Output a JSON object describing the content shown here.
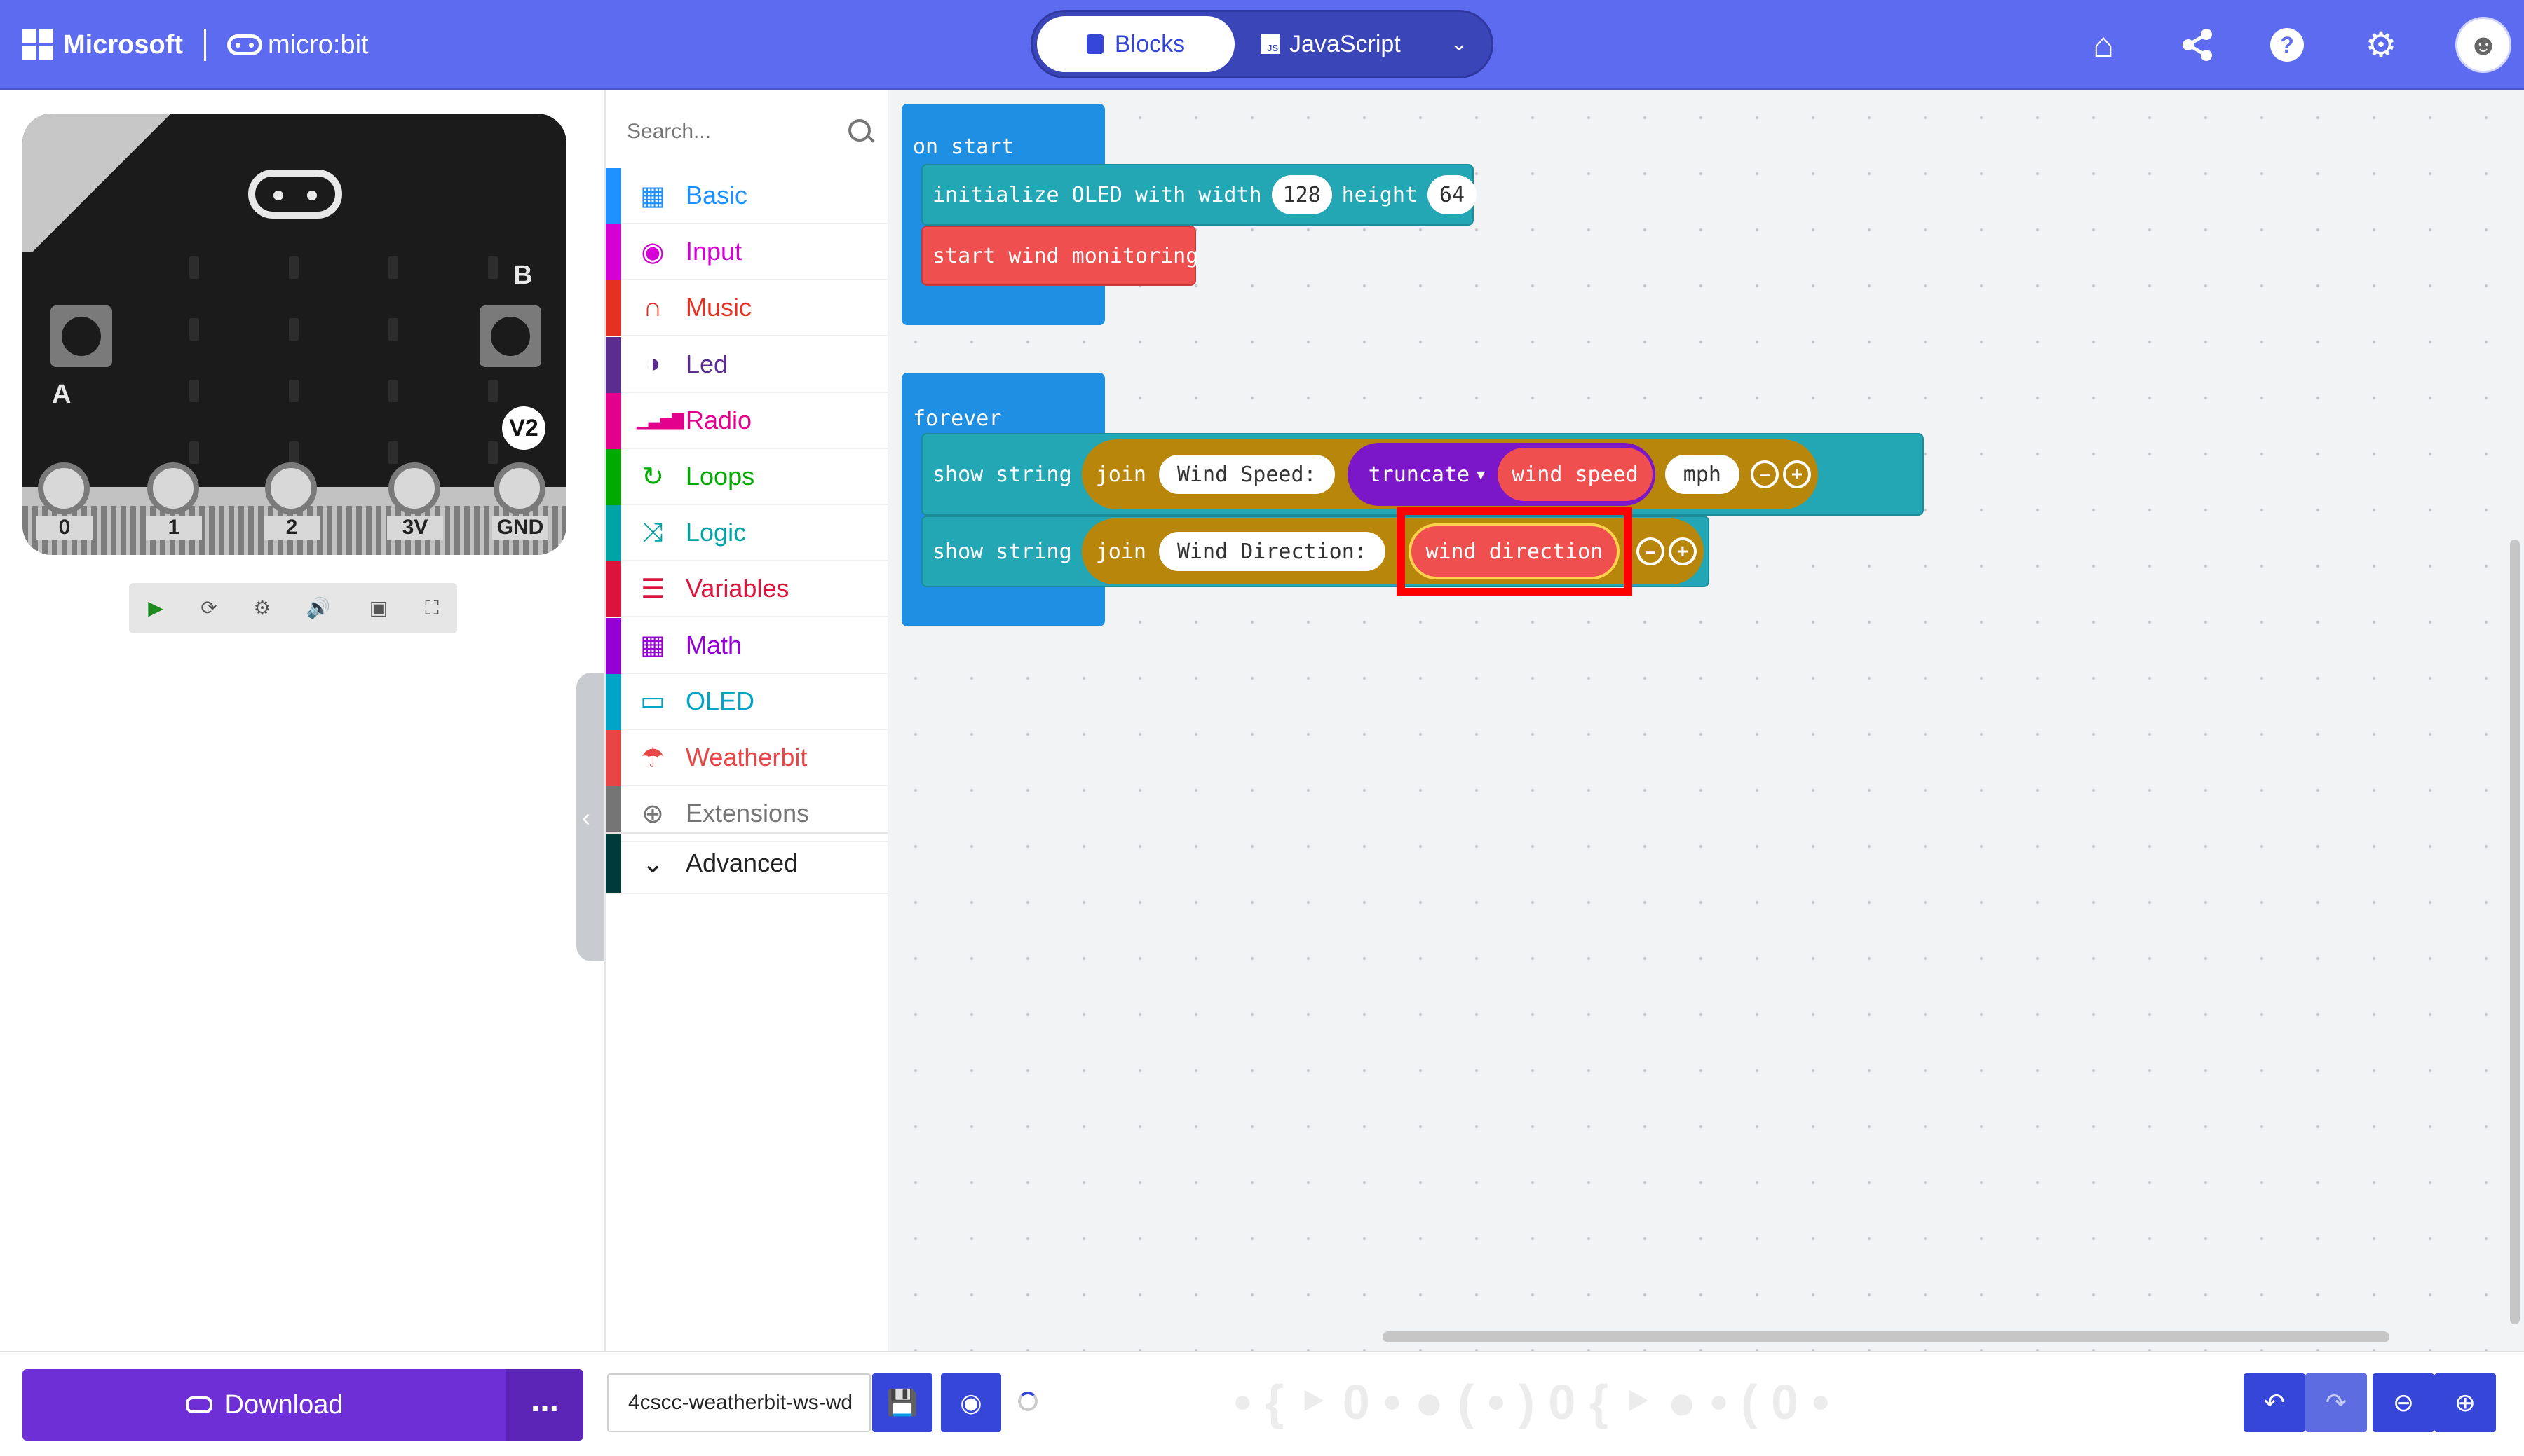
{
  "header": {
    "brand": "Microsoft",
    "product": "micro:bit",
    "modes": {
      "blocks": "Blocks",
      "javascript": "JavaScript"
    },
    "js_icon_text": "JS",
    "icons": [
      "home-icon",
      "share-icon",
      "help-icon",
      "settings-icon",
      "user-avatar"
    ]
  },
  "simulator": {
    "button_a": "A",
    "button_b": "B",
    "version_badge": "V2",
    "pins": [
      "0",
      "1",
      "2",
      "3V",
      "GND"
    ],
    "toolbar_icons": [
      "play-icon",
      "restart-icon",
      "debug-icon",
      "mute-icon",
      "screenshot-icon",
      "fullscreen-icon"
    ]
  },
  "toolbox": {
    "search_placeholder": "Search...",
    "categories": [
      {
        "label": "Basic",
        "color": "#1e90ff",
        "icon": "grid-icon"
      },
      {
        "label": "Input",
        "color": "#d400d4",
        "icon": "target-icon"
      },
      {
        "label": "Music",
        "color": "#e63022",
        "icon": "headphones-icon"
      },
      {
        "label": "Led",
        "color": "#5c2d91",
        "icon": "toggle-icon"
      },
      {
        "label": "Radio",
        "color": "#e3008c",
        "icon": "signal-icon"
      },
      {
        "label": "Loops",
        "color": "#00aa00",
        "icon": "loop-icon"
      },
      {
        "label": "Logic",
        "color": "#00a4a6",
        "icon": "shuffle-icon"
      },
      {
        "label": "Variables",
        "color": "#dc143c",
        "icon": "list-icon"
      },
      {
        "label": "Math",
        "color": "#9400d3",
        "icon": "calculator-icon"
      },
      {
        "label": "OLED",
        "color": "#00a4c6",
        "icon": "monitor-icon"
      },
      {
        "label": "Weatherbit",
        "color": "#e84545",
        "icon": "weather-icon"
      },
      {
        "label": "Extensions",
        "color": "#757575",
        "icon": "plus-circle-icon"
      }
    ],
    "advanced": {
      "label": "Advanced",
      "color": "#003b3b"
    }
  },
  "workspace": {
    "on_start": {
      "label": "on start",
      "oled_init": {
        "prefix": "initialize OLED with width",
        "width": "128",
        "height_label": "height",
        "height": "64"
      },
      "monitor": "start wind monitoring"
    },
    "forever": {
      "label": "forever",
      "row1": {
        "show": "show string",
        "join": "join",
        "str1": "Wind Speed: ",
        "truncate": "truncate",
        "var": "wind speed",
        "str2": " mph"
      },
      "row2": {
        "show": "show string",
        "join": "join",
        "str1": "Wind Direction: ",
        "var": "wind direction"
      }
    },
    "highlight_color": "#ff0000"
  },
  "footer": {
    "download_label": "Download",
    "more_label": "...",
    "project_name": "4cscc-weatherbit-ws-wd"
  },
  "colors": {
    "header": "#5c6bf0",
    "event_block": "#1f8fe3",
    "oled_block": "#23a7b5",
    "weatherbit_block": "#ef4f4f",
    "text_block": "#b8860b",
    "math_block": "#7b16c9",
    "download": "#6e2fd6"
  }
}
